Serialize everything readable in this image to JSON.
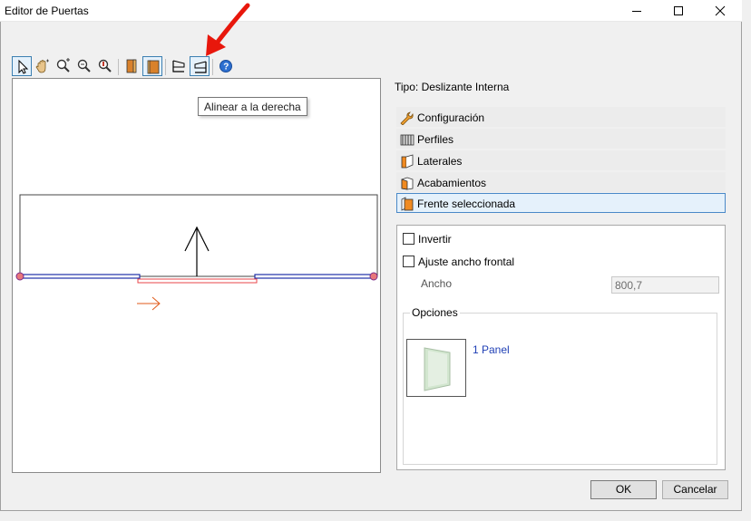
{
  "window": {
    "title": "Editor de Puertas",
    "controls": [
      "minimize-icon",
      "maximize-icon",
      "close-icon"
    ]
  },
  "toolbar": {
    "buttons": [
      {
        "name": "select-pointer-icon",
        "active": true
      },
      {
        "name": "pan-hand-icon"
      },
      {
        "name": "zoom-in-icon"
      },
      {
        "name": "zoom-out-icon"
      },
      {
        "name": "zoom-window-icon"
      },
      {
        "name": "door-left-icon"
      },
      {
        "name": "door-right-icon",
        "active": true
      },
      {
        "name": "align-left-icon"
      },
      {
        "name": "align-right-icon",
        "active": true
      },
      {
        "name": "help-icon"
      }
    ],
    "tooltip": "Alinear a la derecha"
  },
  "right": {
    "tipo": "Tipo: Deslizante Interna",
    "sections": [
      {
        "label": "Configuración",
        "icon": "wrench-icon"
      },
      {
        "label": "Perfiles",
        "icon": "profiles-icon"
      },
      {
        "label": "Laterales",
        "icon": "laterals-icon"
      },
      {
        "label": "Acabamientos",
        "icon": "finishes-icon"
      },
      {
        "label": "Frente seleccionada",
        "icon": "front-icon",
        "selected": true
      }
    ],
    "panel": {
      "invertir": "Invertir",
      "ajuste": "Ajuste ancho frontal",
      "ancho_label": "Ancho",
      "ancho_value": "800,7",
      "opciones_label": "Opciones",
      "option": "1 Panel"
    }
  },
  "buttons": {
    "ok": "OK",
    "cancel": "Cancelar"
  },
  "colors": {
    "accent": "#4a89c8",
    "selected_bg": "#e5f1fb",
    "arrow_red": "#e8170c",
    "link_blue": "#1f3fb5"
  }
}
